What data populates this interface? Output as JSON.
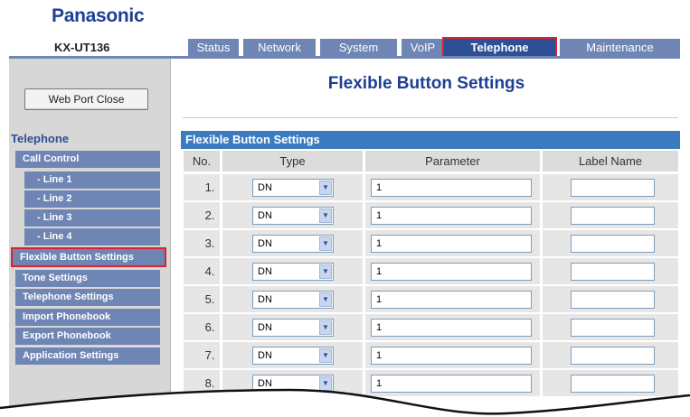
{
  "brand": "Panasonic",
  "model": "KX-UT136",
  "tabs": [
    {
      "label": "Status"
    },
    {
      "label": "Network"
    },
    {
      "label": "System"
    },
    {
      "label": "VoIP"
    },
    {
      "label": "Telephone"
    },
    {
      "label": "Maintenance"
    }
  ],
  "active_tab": "Telephone",
  "web_port_close": "Web Port Close",
  "sidebar": {
    "heading": "Telephone",
    "items": [
      {
        "label": "Call Control"
      },
      {
        "label": "- Line 1"
      },
      {
        "label": "- Line 2"
      },
      {
        "label": "- Line 3"
      },
      {
        "label": "- Line 4"
      },
      {
        "label": "Flexible Button Settings"
      },
      {
        "label": "Tone Settings"
      },
      {
        "label": "Telephone Settings"
      },
      {
        "label": "Import Phonebook"
      },
      {
        "label": "Export Phonebook"
      },
      {
        "label": "Application Settings"
      }
    ],
    "selected": "Flexible Button Settings"
  },
  "page_title": "Flexible Button Settings",
  "section_title": "Flexible Button Settings",
  "table": {
    "headers": [
      "No.",
      "Type",
      "Parameter",
      "Label Name"
    ],
    "rows": [
      {
        "no": "1.",
        "type": "DN",
        "parameter": "1",
        "label_name": ""
      },
      {
        "no": "2.",
        "type": "DN",
        "parameter": "1",
        "label_name": ""
      },
      {
        "no": "3.",
        "type": "DN",
        "parameter": "1",
        "label_name": ""
      },
      {
        "no": "4.",
        "type": "DN",
        "parameter": "1",
        "label_name": ""
      },
      {
        "no": "5.",
        "type": "DN",
        "parameter": "1",
        "label_name": ""
      },
      {
        "no": "6.",
        "type": "DN",
        "parameter": "1",
        "label_name": ""
      },
      {
        "no": "7.",
        "type": "DN",
        "parameter": "1",
        "label_name": ""
      },
      {
        "no": "8.",
        "type": "DN",
        "parameter": "1",
        "label_name": ""
      }
    ]
  },
  "colors": {
    "brand": "#1d3f93",
    "tab": "#6f85b4",
    "tab_active": "#2d4f96",
    "section_bar": "#3b7bbf",
    "highlight": "#e0202a"
  }
}
